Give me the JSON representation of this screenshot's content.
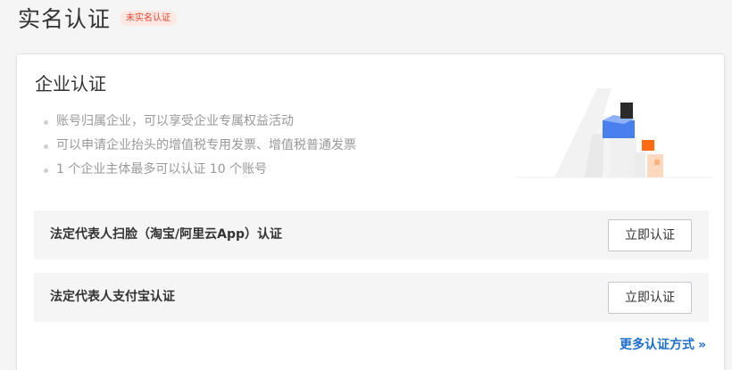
{
  "header": {
    "title": "实名认证",
    "status_badge": "未实名认证"
  },
  "card": {
    "title": "企业认证",
    "benefits": [
      "账号归属企业，可以享受企业专属权益活动",
      "可以申请企业抬头的增值税专用发票、增值税普通发票",
      "1 个企业主体最多可以认证 10 个账号"
    ],
    "methods": [
      {
        "label": "法定代表人扫脸（淘宝/阿里云App）认证",
        "button_label": "立即认证"
      },
      {
        "label": "法定代表人支付宝认证",
        "button_label": "立即认证"
      }
    ],
    "more_link": "更多认证方式",
    "more_link_icon": "double-chevron-right-icon"
  },
  "colors": {
    "badge_text": "#e8462f",
    "badge_bg": "#fde8e4",
    "link": "#1e6fc9",
    "building_blue": "#4a7ff0",
    "building_orange": "#ff6a13"
  }
}
